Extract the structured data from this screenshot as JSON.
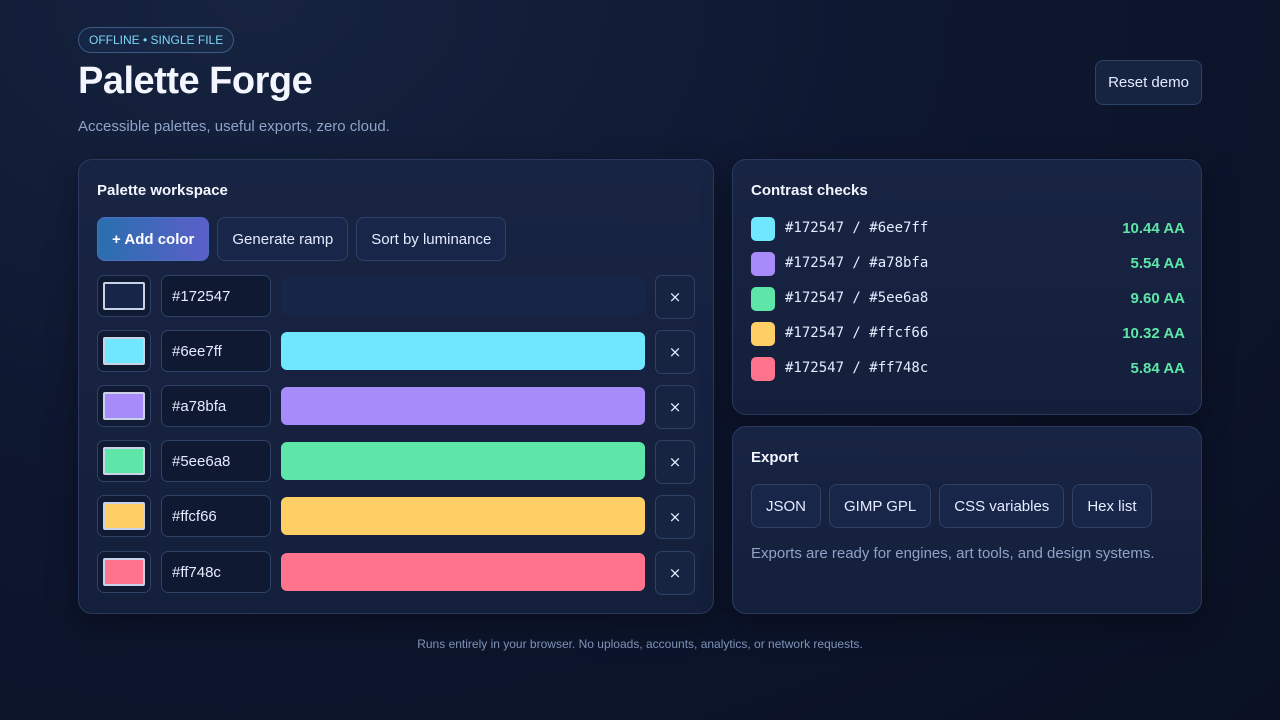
{
  "header": {
    "badge": "OFFLINE • SINGLE FILE",
    "title": "Palette Forge",
    "subtitle": "Accessible palettes, useful exports, zero cloud.",
    "reset_label": "Reset demo"
  },
  "workspace": {
    "title": "Palette workspace",
    "add_label": "+ Add color",
    "ramp_label": "Generate ramp",
    "sort_label": "Sort by luminance",
    "remove_glyph": "×",
    "colors": [
      {
        "hex": "#172547"
      },
      {
        "hex": "#6ee7ff"
      },
      {
        "hex": "#a78bfa"
      },
      {
        "hex": "#5ee6a8"
      },
      {
        "hex": "#ffcf66"
      },
      {
        "hex": "#ff748c"
      }
    ]
  },
  "contrast": {
    "title": "Contrast checks",
    "checks": [
      {
        "pair": "#172547 / #6ee7ff",
        "score": "10.44 AA",
        "swatch": "#6ee7ff"
      },
      {
        "pair": "#172547 / #a78bfa",
        "score": "5.54 AA",
        "swatch": "#a78bfa"
      },
      {
        "pair": "#172547 / #5ee6a8",
        "score": "9.60 AA",
        "swatch": "#5ee6a8"
      },
      {
        "pair": "#172547 / #ffcf66",
        "score": "10.32 AA",
        "swatch": "#ffcf66"
      },
      {
        "pair": "#172547 / #ff748c",
        "score": "5.84 AA",
        "swatch": "#ff748c"
      }
    ]
  },
  "export": {
    "title": "Export",
    "buttons": [
      "JSON",
      "GIMP GPL",
      "CSS variables",
      "Hex list"
    ],
    "note": "Exports are ready for engines, art tools, and design systems."
  },
  "footer": "Runs entirely in your browser. No uploads, accounts, analytics, or network requests."
}
